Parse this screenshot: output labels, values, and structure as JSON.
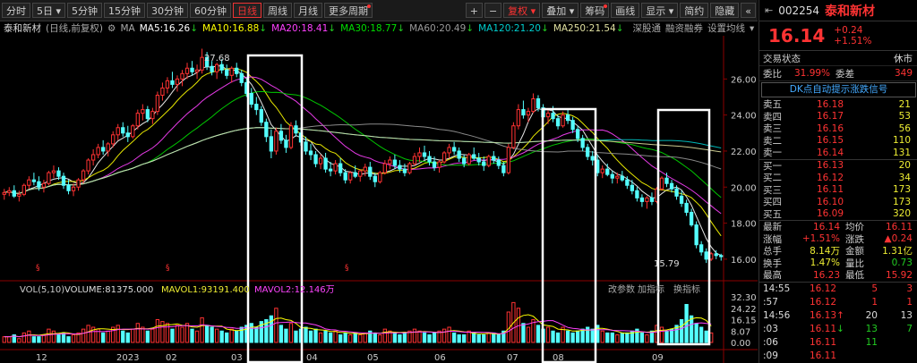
{
  "toolbar": {
    "periods": [
      "分时",
      "5日",
      "5分钟",
      "15分钟",
      "30分钟",
      "60分钟",
      "日线",
      "周线",
      "月线",
      "更多周期"
    ],
    "active_period": "日线",
    "plus": "+",
    "minus": "−",
    "fuquan": "复权",
    "overlay": "叠加",
    "chips": "筹码",
    "draw": "画线",
    "display": "显示",
    "simple": "简约",
    "hide": "隐藏"
  },
  "info": {
    "name": "泰和新材",
    "mode": "(日线,前复权)",
    "ma_label": "MA",
    "ma": [
      {
        "label": "MA5:16.26",
        "arrow": "↓",
        "color": "#ffffff"
      },
      {
        "label": "MA10:16.88",
        "arrow": "↓",
        "color": "#ffff00"
      },
      {
        "label": "MA20:18.41",
        "arrow": "↓",
        "color": "#ff40ff"
      },
      {
        "label": "MA30:18.77",
        "arrow": "↓",
        "color": "#00dd00"
      },
      {
        "label": "MA60:20.49",
        "arrow": "↓",
        "color": "#999999"
      },
      {
        "label": "MA120:21.20",
        "arrow": "↓",
        "color": "#00cccc"
      },
      {
        "label": "MA250:21.54",
        "arrow": "↓",
        "color": "#e0e0a0"
      }
    ],
    "links": [
      "深股通",
      "融资融券",
      "设置均线"
    ]
  },
  "chart_data": {
    "type": "candlestick",
    "y_ticks": [
      "26.00",
      "24.00",
      "22.00",
      "20.00",
      "18.00",
      "16.00"
    ],
    "ylim": [
      15.2,
      28.2
    ],
    "high_label": "27.68",
    "low_label": "15.79",
    "x_labels": [
      "12",
      "2023",
      "02",
      "03",
      "04",
      "05",
      "06",
      "07",
      "08",
      "09"
    ],
    "ohlc": [
      [
        19.6,
        19.9,
        19.3,
        19.7
      ],
      [
        19.7,
        20.0,
        19.5,
        19.8
      ],
      [
        19.8,
        20.1,
        19.4,
        19.5
      ],
      [
        19.5,
        19.8,
        19.2,
        19.6
      ],
      [
        19.6,
        20.2,
        19.5,
        20.1
      ],
      [
        20.1,
        20.6,
        19.9,
        20.4
      ],
      [
        20.4,
        20.8,
        20.1,
        20.3
      ],
      [
        20.3,
        20.6,
        19.8,
        20.0
      ],
      [
        20.0,
        20.4,
        19.7,
        20.2
      ],
      [
        20.2,
        20.9,
        20.1,
        20.8
      ],
      [
        20.8,
        21.2,
        20.5,
        20.9
      ],
      [
        20.9,
        21.1,
        20.4,
        20.6
      ],
      [
        20.6,
        20.8,
        19.9,
        20.1
      ],
      [
        20.1,
        20.4,
        19.6,
        19.8
      ],
      [
        19.8,
        20.2,
        19.5,
        20.0
      ],
      [
        20.0,
        20.5,
        19.8,
        20.4
      ],
      [
        20.4,
        21.0,
        20.2,
        20.9
      ],
      [
        20.9,
        21.6,
        20.7,
        21.5
      ],
      [
        21.5,
        22.1,
        21.2,
        21.8
      ],
      [
        21.8,
        22.4,
        21.6,
        22.2
      ],
      [
        22.2,
        22.6,
        21.8,
        22.0
      ],
      [
        22.0,
        22.5,
        21.7,
        22.4
      ],
      [
        22.4,
        23.1,
        22.2,
        22.9
      ],
      [
        22.9,
        23.5,
        22.6,
        23.3
      ],
      [
        23.3,
        23.6,
        22.8,
        23.0
      ],
      [
        23.0,
        23.4,
        22.5,
        22.8
      ],
      [
        22.8,
        23.5,
        22.7,
        23.4
      ],
      [
        23.4,
        24.3,
        23.2,
        24.1
      ],
      [
        24.1,
        24.6,
        23.7,
        24.3
      ],
      [
        24.3,
        24.5,
        23.6,
        23.8
      ],
      [
        23.8,
        24.4,
        23.5,
        24.2
      ],
      [
        24.2,
        25.3,
        24.0,
        25.1
      ],
      [
        25.1,
        25.8,
        24.8,
        25.5
      ],
      [
        25.5,
        26.1,
        25.2,
        25.9
      ],
      [
        25.9,
        26.4,
        25.5,
        25.7
      ],
      [
        25.7,
        26.2,
        25.3,
        26.0
      ],
      [
        26.0,
        26.5,
        25.6,
        26.3
      ],
      [
        26.3,
        26.9,
        26.0,
        26.6
      ],
      [
        26.6,
        27.0,
        26.2,
        26.4
      ],
      [
        26.4,
        26.8,
        26.0,
        26.5
      ],
      [
        26.5,
        27.68,
        26.3,
        27.2
      ],
      [
        27.2,
        27.5,
        26.5,
        26.7
      ],
      [
        26.7,
        27.0,
        26.2,
        26.4
      ],
      [
        26.4,
        26.9,
        26.0,
        26.8
      ],
      [
        26.8,
        27.1,
        26.3,
        26.5
      ],
      [
        26.5,
        26.8,
        26.0,
        26.2
      ],
      [
        26.2,
        26.7,
        25.8,
        26.6
      ],
      [
        26.6,
        26.9,
        26.1,
        26.3
      ],
      [
        26.3,
        26.5,
        25.6,
        25.8
      ],
      [
        25.8,
        26.0,
        25.0,
        25.2
      ],
      [
        25.2,
        25.5,
        24.4,
        24.6
      ],
      [
        24.6,
        25.0,
        24.0,
        24.3
      ],
      [
        24.3,
        24.5,
        23.4,
        23.6
      ],
      [
        23.6,
        23.8,
        22.5,
        22.8
      ],
      [
        22.8,
        23.2,
        21.6,
        22.0
      ],
      [
        22.0,
        23.3,
        21.8,
        23.1
      ],
      [
        23.1,
        23.5,
        22.4,
        22.6
      ],
      [
        22.6,
        22.9,
        21.9,
        22.2
      ],
      [
        22.2,
        23.6,
        22.1,
        23.4
      ],
      [
        23.4,
        23.7,
        22.8,
        23.0
      ],
      [
        23.0,
        23.2,
        22.3,
        22.5
      ],
      [
        22.5,
        22.8,
        21.8,
        22.0
      ],
      [
        22.0,
        22.4,
        21.5,
        21.8
      ],
      [
        21.8,
        22.0,
        21.1,
        21.3
      ],
      [
        21.3,
        21.8,
        21.0,
        21.6
      ],
      [
        21.6,
        21.9,
        20.8,
        21.0
      ],
      [
        21.0,
        21.4,
        20.6,
        20.9
      ],
      [
        20.9,
        21.5,
        20.7,
        21.3
      ],
      [
        21.3,
        21.6,
        20.6,
        20.8
      ],
      [
        20.8,
        21.0,
        20.2,
        20.4
      ],
      [
        20.4,
        20.9,
        20.2,
        20.8
      ],
      [
        20.8,
        21.2,
        20.5,
        20.6
      ],
      [
        20.6,
        21.0,
        20.3,
        20.9
      ],
      [
        20.9,
        21.3,
        20.6,
        21.1
      ],
      [
        21.1,
        21.4,
        20.4,
        20.6
      ],
      [
        20.6,
        20.8,
        20.0,
        20.3
      ],
      [
        20.3,
        20.9,
        20.2,
        20.8
      ],
      [
        20.8,
        21.5,
        20.7,
        21.3
      ],
      [
        21.3,
        21.7,
        21.0,
        21.5
      ],
      [
        21.5,
        21.8,
        21.0,
        21.2
      ],
      [
        21.2,
        21.5,
        20.8,
        21.0
      ],
      [
        21.0,
        21.3,
        20.6,
        20.8
      ],
      [
        20.8,
        21.4,
        20.7,
        21.3
      ],
      [
        21.3,
        21.9,
        21.2,
        21.7
      ],
      [
        21.7,
        22.2,
        21.4,
        21.9
      ],
      [
        21.9,
        22.3,
        21.5,
        21.7
      ],
      [
        21.7,
        22.0,
        21.2,
        21.4
      ],
      [
        21.4,
        21.7,
        20.9,
        21.1
      ],
      [
        21.1,
        21.5,
        20.8,
        21.4
      ],
      [
        21.4,
        22.0,
        21.3,
        21.9
      ],
      [
        21.9,
        22.4,
        21.6,
        22.2
      ],
      [
        22.2,
        22.5,
        21.8,
        22.0
      ],
      [
        22.0,
        22.2,
        21.4,
        21.6
      ],
      [
        21.6,
        21.8,
        21.1,
        21.3
      ],
      [
        21.3,
        21.9,
        21.2,
        21.8
      ],
      [
        21.8,
        22.2,
        21.5,
        21.6
      ],
      [
        21.6,
        21.9,
        21.2,
        21.4
      ],
      [
        21.4,
        21.7,
        20.9,
        21.2
      ],
      [
        21.2,
        21.8,
        21.1,
        21.7
      ],
      [
        21.7,
        22.0,
        21.3,
        21.5
      ],
      [
        21.5,
        21.7,
        21.0,
        21.2
      ],
      [
        21.2,
        21.4,
        20.6,
        20.8
      ],
      [
        20.8,
        22.4,
        20.7,
        22.2
      ],
      [
        22.2,
        23.6,
        22.1,
        23.4
      ],
      [
        23.4,
        24.6,
        23.2,
        24.3
      ],
      [
        24.3,
        24.8,
        23.8,
        24.0
      ],
      [
        24.0,
        24.4,
        23.6,
        24.2
      ],
      [
        24.2,
        25.2,
        24.1,
        24.9
      ],
      [
        24.9,
        25.1,
        24.2,
        24.4
      ],
      [
        24.4,
        24.6,
        23.7,
        23.9
      ],
      [
        23.9,
        24.3,
        23.5,
        24.1
      ],
      [
        24.1,
        24.5,
        23.6,
        23.8
      ],
      [
        23.8,
        24.0,
        23.2,
        23.4
      ],
      [
        23.4,
        24.2,
        23.3,
        24.0
      ],
      [
        24.0,
        24.3,
        23.5,
        23.7
      ],
      [
        23.7,
        23.9,
        23.0,
        23.2
      ],
      [
        23.2,
        23.4,
        22.5,
        22.7
      ],
      [
        22.7,
        22.9,
        22.0,
        22.2
      ],
      [
        22.2,
        22.4,
        21.5,
        21.7
      ],
      [
        21.7,
        22.0,
        21.2,
        21.5
      ],
      [
        21.5,
        21.8,
        20.6,
        20.8
      ],
      [
        20.8,
        21.2,
        20.5,
        21.0
      ],
      [
        21.0,
        21.3,
        20.6,
        20.7
      ],
      [
        20.7,
        20.9,
        20.2,
        20.5
      ],
      [
        20.5,
        20.8,
        20.2,
        20.6
      ],
      [
        20.6,
        20.9,
        20.3,
        20.4
      ],
      [
        20.4,
        20.6,
        19.9,
        20.1
      ],
      [
        20.1,
        20.4,
        19.6,
        19.8
      ],
      [
        19.8,
        20.0,
        19.2,
        19.4
      ],
      [
        19.4,
        19.6,
        18.9,
        19.2
      ],
      [
        19.2,
        19.5,
        18.8,
        19.4
      ],
      [
        19.4,
        19.7,
        19.0,
        19.2
      ],
      [
        19.2,
        20.0,
        19.1,
        19.9
      ],
      [
        19.9,
        20.6,
        19.8,
        20.5
      ],
      [
        20.5,
        20.8,
        20.0,
        20.2
      ],
      [
        20.2,
        20.4,
        19.7,
        19.9
      ],
      [
        19.9,
        20.1,
        19.3,
        19.5
      ],
      [
        19.5,
        19.8,
        18.9,
        19.1
      ],
      [
        19.1,
        19.3,
        18.4,
        18.6
      ],
      [
        18.6,
        18.8,
        17.8,
        17.9
      ],
      [
        17.9,
        18.1,
        16.6,
        16.8
      ],
      [
        16.8,
        17.0,
        16.2,
        16.4
      ],
      [
        16.4,
        16.6,
        15.79,
        16.0
      ],
      [
        16.0,
        16.4,
        15.9,
        16.3
      ],
      [
        16.3,
        16.5,
        16.0,
        16.2
      ],
      [
        16.2,
        16.3,
        15.92,
        16.14
      ]
    ],
    "vol": [
      3,
      3,
      4,
      2,
      5,
      6,
      3,
      3,
      4,
      7,
      6,
      4,
      5,
      3,
      4,
      5,
      7,
      9,
      8,
      7,
      5,
      6,
      8,
      9,
      6,
      5,
      7,
      10,
      8,
      6,
      7,
      12,
      11,
      10,
      7,
      9,
      8,
      10,
      7,
      6,
      13,
      9,
      8,
      7,
      6,
      5,
      7,
      6,
      8,
      9,
      10,
      8,
      11,
      12,
      14,
      18,
      9,
      7,
      10,
      6,
      7,
      8,
      6,
      7,
      5,
      6,
      5,
      6,
      4,
      5,
      4,
      5,
      4,
      5,
      6,
      5,
      4,
      7,
      6,
      5,
      4,
      5,
      6,
      7,
      6,
      5,
      4,
      5,
      6,
      7,
      8,
      5,
      4,
      4,
      6,
      5,
      4,
      4,
      5,
      5,
      4,
      6,
      16,
      21,
      18,
      10,
      8,
      12,
      9,
      7,
      8,
      6,
      5,
      8,
      6,
      5,
      6,
      7,
      8,
      7,
      9,
      6,
      5,
      5,
      4,
      5,
      5,
      6,
      7,
      5,
      4,
      6,
      9,
      8,
      6,
      7,
      9,
      12,
      20,
      14,
      10,
      8,
      6,
      5
    ],
    "vol_ticks": [
      "32.30",
      "24.22",
      "16.15",
      "8.07",
      "0.00"
    ],
    "vol_max": 32.3
  },
  "vol_panel": {
    "title": "VOL(5,10)",
    "volume": "VOLUME:81375.000",
    "mavol1": "MAVOL1:93191.400",
    "mavol2": "MAVOL2:12.146万",
    "links": [
      "改参数",
      "加指标",
      "换指标"
    ]
  },
  "right": {
    "code": "002254",
    "name": "泰和新材",
    "price": "16.14",
    "change": "+0.24",
    "pct": "+1.51%",
    "status_label": "交易状态",
    "status_value": "休市",
    "weibi_label": "委比",
    "weibi": "31.99%",
    "weicha_label": "委差",
    "weicha": "349",
    "signal": "DK点自动提示涨跌信号",
    "sells": [
      {
        "label": "卖五",
        "price": "16.18",
        "vol": "21"
      },
      {
        "label": "卖四",
        "price": "16.17",
        "vol": "53"
      },
      {
        "label": "卖三",
        "price": "16.16",
        "vol": "56"
      },
      {
        "label": "卖二",
        "price": "16.15",
        "vol": "110"
      },
      {
        "label": "卖一",
        "price": "16.14",
        "vol": "131"
      }
    ],
    "buys": [
      {
        "label": "买一",
        "price": "16.13",
        "vol": "20"
      },
      {
        "label": "买二",
        "price": "16.12",
        "vol": "34"
      },
      {
        "label": "买三",
        "price": "16.11",
        "vol": "173"
      },
      {
        "label": "买四",
        "price": "16.10",
        "vol": "173"
      },
      {
        "label": "买五",
        "price": "16.09",
        "vol": "320"
      }
    ],
    "stats": [
      {
        "l1": "最新",
        "v1": "16.14",
        "c1": "red",
        "l2": "均价",
        "v2": "16.11",
        "c2": "red"
      },
      {
        "l1": "涨幅",
        "v1": "+1.51%",
        "c1": "red",
        "l2": "涨跌",
        "v2": "▲0.24",
        "c2": "red"
      },
      {
        "l1": "总手",
        "v1": "8.14万",
        "c1": "yellow",
        "l2": "金额",
        "v2": "1.31亿",
        "c2": "yellow"
      },
      {
        "l1": "换手",
        "v1": "1.47%",
        "c1": "yellow",
        "l2": "量比",
        "v2": "0.73",
        "c2": "green"
      },
      {
        "l1": "最高",
        "v1": "16.23",
        "c1": "red",
        "l2": "最低",
        "v2": "15.92",
        "c2": "red"
      }
    ],
    "ticks": [
      {
        "time": "14:55",
        "price": "16.12",
        "vol": "5",
        "n": "3",
        "pc": "red",
        "vc": "red",
        "arrow": ""
      },
      {
        "time": ":57",
        "price": "16.12",
        "vol": "1",
        "n": "1",
        "pc": "red",
        "vc": "red",
        "arrow": ""
      },
      {
        "time": "14:56",
        "price": "16.13",
        "vol": "20",
        "n": "13",
        "pc": "red",
        "vc": "white",
        "arrow": "↑"
      },
      {
        "time": ":03",
        "price": "16.11",
        "vol": "13",
        "n": "7",
        "pc": "red",
        "vc": "green",
        "arrow": "↓"
      },
      {
        "time": ":06",
        "price": "16.11",
        "vol": "11",
        "n": "",
        "pc": "red",
        "vc": "green",
        "arrow": ""
      },
      {
        "time": ":09",
        "price": "16.11",
        "vol": "",
        "n": "",
        "pc": "red",
        "vc": "green",
        "arrow": ""
      }
    ]
  },
  "colors": {
    "up": "#ff3232",
    "down": "#54ffff",
    "box": "#ffffff"
  }
}
